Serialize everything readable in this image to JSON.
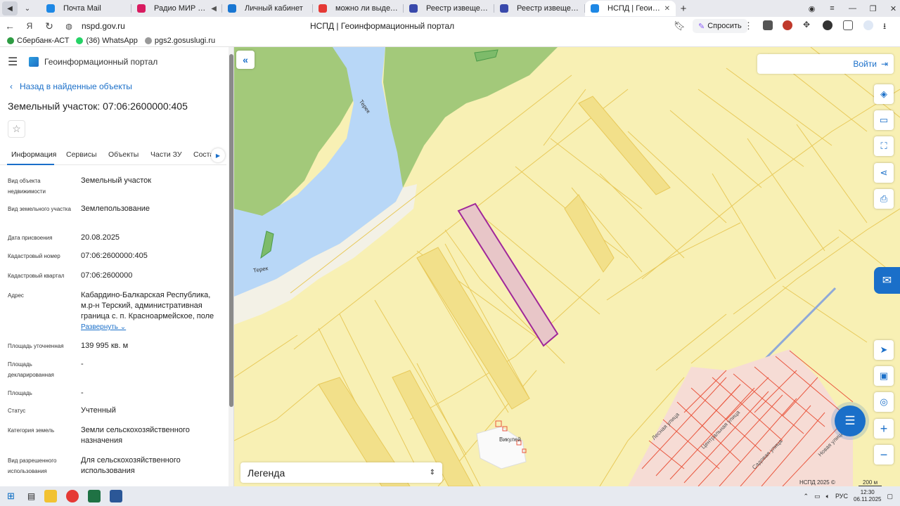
{
  "browser": {
    "tabs": [
      {
        "title": "Почта Mail",
        "color": "#1e88e5",
        "active": false,
        "sound": false
      },
      {
        "title": "Радио МИР — слуш",
        "color": "#d81b60",
        "active": false,
        "sound": true
      },
      {
        "title": "Личный кабинет",
        "color": "#1976d2",
        "active": false,
        "sound": false
      },
      {
        "title": "можно ли выделить доли",
        "color": "#e53935",
        "active": false,
        "sound": false
      },
      {
        "title": "Реестр извещений",
        "color": "#3949ab",
        "active": false,
        "sound": false
      },
      {
        "title": "Реестр извещений",
        "color": "#3949ab",
        "active": false,
        "sound": false
      },
      {
        "title": "НСПД | Геоинформац",
        "color": "#1e88e5",
        "active": true,
        "sound": false
      }
    ],
    "url": "nspd.gov.ru",
    "page_title": "НСПД | Геоинформационный портал",
    "ask_label": "Спросить",
    "bookmarks": [
      {
        "label": "Сбербанк-АСТ",
        "color": "#2e9c43"
      },
      {
        "label": "(36) WhatsApp",
        "color": "#25d366"
      },
      {
        "label": "pgs2.gosuslugi.ru",
        "color": "#999999"
      }
    ]
  },
  "panel": {
    "portal_name": "Геоинформационный портал",
    "back_label": "Назад в найденные объекты",
    "title": "Земельный участок: 07:06:2600000:405",
    "tabs": [
      "Информация",
      "Сервисы",
      "Объекты",
      "Части ЗУ",
      "Соста"
    ],
    "fields": [
      {
        "label": "Вид объекта недвижимости",
        "value": "Земельный участок"
      },
      {
        "label": "Вид земельного участка",
        "value": "Землепользование"
      },
      {
        "label": "Дата присвоения",
        "value": "20.08.2025"
      },
      {
        "label": "Кадастровый номер",
        "value": "07:06:2600000:405"
      },
      {
        "label": "Кадастровый квартал",
        "value": "07:06:2600000"
      },
      {
        "label": "Адрес",
        "value": "Кабардино-Балкарская Республика, м.р-н Терский, административная граница с. п. Красноармейское, поле"
      },
      {
        "label": "Площадь уточненная",
        "value": "139 995 кв. м"
      },
      {
        "label": "Площадь декларированная",
        "value": "-"
      },
      {
        "label": "Площадь",
        "value": "-"
      },
      {
        "label": "Статус",
        "value": "Учтенный"
      },
      {
        "label": "Категория земель",
        "value": "Земли сельскохозяйственного назначения"
      },
      {
        "label": "Вид разрешенного использования",
        "value": "Для сельскохозяйственного использования"
      }
    ],
    "expand_label": "Развернуть"
  },
  "map": {
    "login_label": "Войти",
    "legend_label": "Легенда",
    "copyright": "НСПД 2025 ©",
    "scale": "200 м",
    "labels": {
      "river1": "Терек",
      "river2": "Терек",
      "village": "Викулей",
      "street1": "Центральная улица",
      "street2": "Лесная улица",
      "street3": "Садовая улица",
      "street4": "Новая улица"
    },
    "colors": {
      "field": "#f8f0b4",
      "parcel_line": "#e8c95a",
      "selected_fill": "#e8c6c8",
      "selected_stroke": "#a0279a",
      "water": "#b8d7f7",
      "forest": "#a3c97a",
      "settlement": "#e9573f"
    }
  },
  "taskbar": {
    "lang": "РУС",
    "time": "12:30",
    "date": "06.11.2025"
  }
}
